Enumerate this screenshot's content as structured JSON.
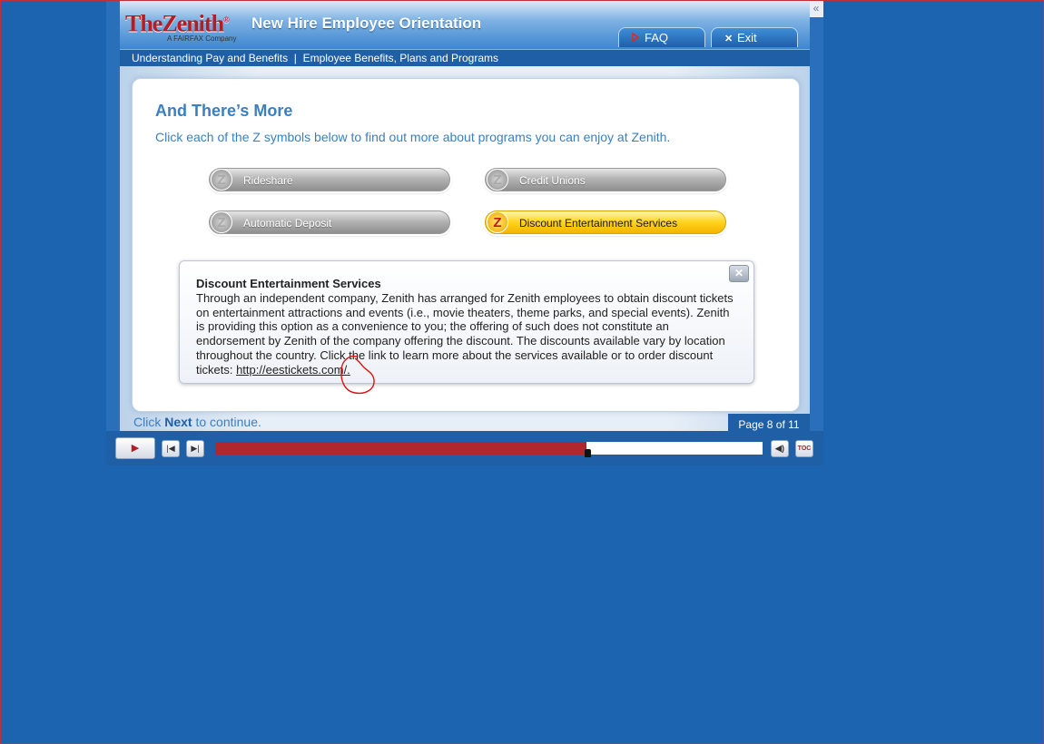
{
  "brand": {
    "logo_text": "TheZenith",
    "logo_sub": "A FAIRFAX Company",
    "app_title": "New Hire Employee Orientation"
  },
  "header": {
    "faq_label": "FAQ",
    "exit_label": "Exit",
    "collapse_glyph": "«"
  },
  "breadcrumb": {
    "text": "Understanding Pay and Benefits  |  Employee Benefits, Plans and Programs"
  },
  "main": {
    "heading": "And There’s More",
    "instruction": "Click each of the Z symbols below to find out more about programs you can enjoy at Zenith.",
    "programs": [
      {
        "label": "Rideshare",
        "icon": "z-logo-icon",
        "active": false
      },
      {
        "label": "Credit Unions",
        "icon": "z-logo-icon",
        "active": false
      },
      {
        "label": "Automatic Deposit",
        "icon": "z-logo-icon",
        "active": false
      },
      {
        "label": "Discount Entertainment Services",
        "icon": "z-logo-icon",
        "active": true
      }
    ],
    "z_glyph": "Z"
  },
  "popup": {
    "title": "Discount Entertainment Services",
    "body": "Through an independent company, Zenith has arranged for Zenith employees to obtain discount tickets on entertainment attractions and events (i.e., movie theaters, theme parks, and special events). Zenith is providing this option as a convenience to you; the offering of such does not constitute an endorsement by Zenith of the company offering the discount. The discounts available vary by location throughout the country. Click the link to learn more about the services available or to order discount tickets: ",
    "link_text": "http://eestickets.com/.",
    "close_glyph": "✕"
  },
  "footer": {
    "prefix": "Click ",
    "next_word": "Next",
    "suffix": " to continue.",
    "page_indicator": "Page 8 of 11"
  },
  "player": {
    "progress_fraction": 0.678,
    "toc_label": "TOC",
    "progress_color": "#b0282e"
  },
  "colors": {
    "accent": "#3a7fc1",
    "brand_red": "#b81c23",
    "background": "#1c63b0",
    "active_button": "#ffd21c"
  }
}
